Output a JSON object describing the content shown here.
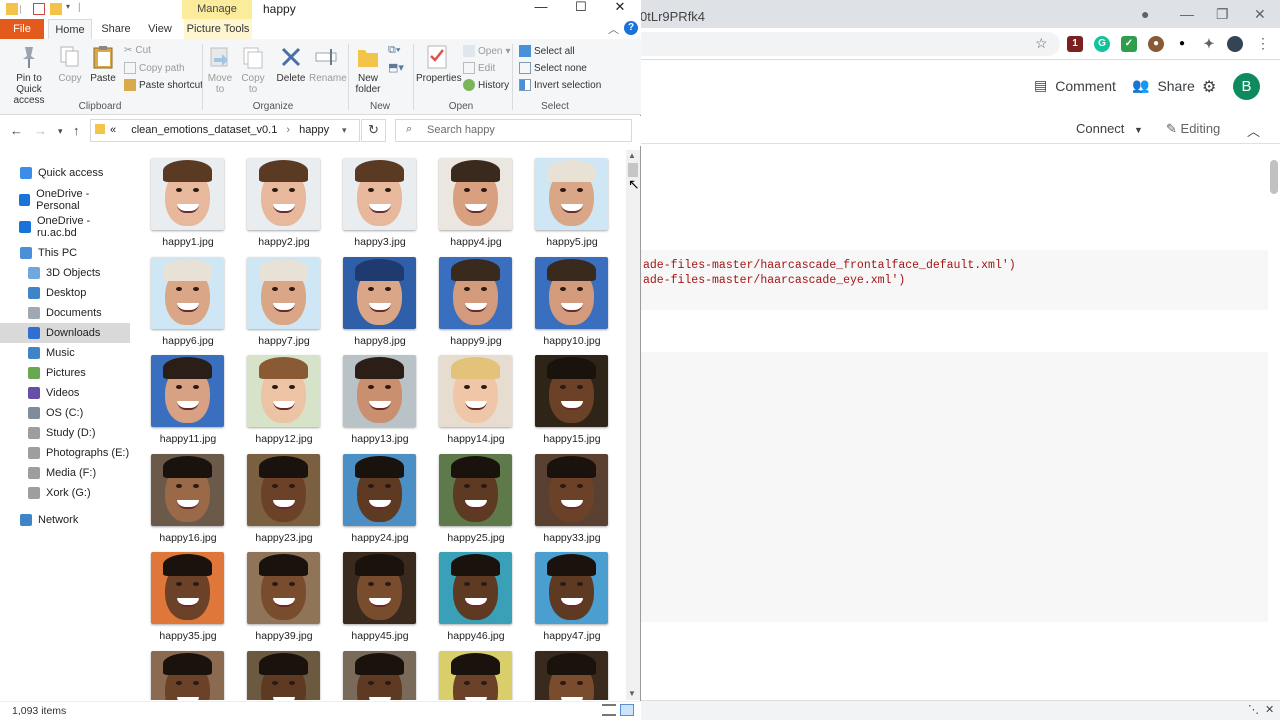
{
  "explorer": {
    "window_title": "happy",
    "manage_label": "Manage",
    "tabs": [
      {
        "label": "File"
      },
      {
        "label": "Home"
      },
      {
        "label": "Share"
      },
      {
        "label": "View"
      },
      {
        "label": "Picture Tools"
      }
    ],
    "ribbon": {
      "clipboard": {
        "pin_label": "Pin to Quick access",
        "copy_label": "Copy",
        "paste_label": "Paste",
        "cut_label": "Cut",
        "copy_path_label": "Copy path",
        "paste_shortcut_label": "Paste shortcut",
        "group_label": "Clipboard"
      },
      "organize": {
        "move_to_label": "Move to",
        "copy_to_label": "Copy to",
        "delete_label": "Delete",
        "rename_label": "Rename",
        "group_label": "Organize"
      },
      "new": {
        "new_folder_label": "New folder",
        "group_label": "New"
      },
      "open": {
        "properties_label": "Properties",
        "open_label": "Open",
        "edit_label": "Edit",
        "history_label": "History",
        "group_label": "Open"
      },
      "select": {
        "select_all_label": "Select all",
        "select_none_label": "Select none",
        "invert_label": "Invert selection",
        "group_label": "Select"
      }
    },
    "address": {
      "path": [
        "clean_emotions_dataset_v0.1",
        "happy"
      ],
      "prefix": "«"
    },
    "search": {
      "placeholder": "Search happy"
    },
    "nav_items": [
      {
        "label": "Quick access",
        "color": "#3b8ee8",
        "indent": 1
      },
      {
        "label": "OneDrive - Personal",
        "color": "#1a73d8",
        "indent": 1
      },
      {
        "label": "OneDrive - ru.ac.bd",
        "color": "#1a73d8",
        "indent": 1
      },
      {
        "label": "This PC",
        "color": "#4a90d9",
        "indent": 1
      },
      {
        "label": "3D Objects",
        "color": "#6fa8dc",
        "indent": 2
      },
      {
        "label": "Desktop",
        "color": "#3d85c6",
        "indent": 2
      },
      {
        "label": "Documents",
        "color": "#9fa8b3",
        "indent": 2
      },
      {
        "label": "Downloads",
        "color": "#2f6fd1",
        "indent": 2,
        "selected": true
      },
      {
        "label": "Music",
        "color": "#3d85c6",
        "indent": 2
      },
      {
        "label": "Pictures",
        "color": "#6aa84f",
        "indent": 2
      },
      {
        "label": "Videos",
        "color": "#674ea7",
        "indent": 2
      },
      {
        "label": "OS (C:)",
        "color": "#7f8c99",
        "indent": 2
      },
      {
        "label": "Study (D:)",
        "color": "#9e9e9e",
        "indent": 2
      },
      {
        "label": "Photographs (E:)",
        "color": "#9e9e9e",
        "indent": 2
      },
      {
        "label": "Media (F:)",
        "color": "#9e9e9e",
        "indent": 2
      },
      {
        "label": "Xork (G:)",
        "color": "#9e9e9e",
        "indent": 2
      },
      {
        "label": "Network",
        "color": "#3d85c6",
        "indent": 1
      }
    ],
    "files": [
      {
        "name": "happy1.jpg",
        "bg": "#e9edf0",
        "skin": "#e7b89b",
        "hair": "#5a3a22"
      },
      {
        "name": "happy2.jpg",
        "bg": "#e9edf0",
        "skin": "#e7b89b",
        "hair": "#5a3a22"
      },
      {
        "name": "happy3.jpg",
        "bg": "#e9edf0",
        "skin": "#e7b89b",
        "hair": "#5a3a22"
      },
      {
        "name": "happy4.jpg",
        "bg": "#ece6e1",
        "skin": "#d9a07f",
        "hair": "#3a2a1e"
      },
      {
        "name": "happy5.jpg",
        "bg": "#cfe6f5",
        "skin": "#d9a787",
        "hair": "#e8e2d6"
      },
      {
        "name": "happy6.jpg",
        "bg": "#cfe6f5",
        "skin": "#d9a787",
        "hair": "#e8e2d6"
      },
      {
        "name": "happy7.jpg",
        "bg": "#cfe6f5",
        "skin": "#d9a787",
        "hair": "#e8e2d6"
      },
      {
        "name": "happy8.jpg",
        "bg": "#2f5fa8",
        "skin": "#d9a787",
        "hair": "#1f3a6e"
      },
      {
        "name": "happy9.jpg",
        "bg": "#3a6fc0",
        "skin": "#d39b7c",
        "hair": "#3a2a1e"
      },
      {
        "name": "happy10.jpg",
        "bg": "#3a6fc0",
        "skin": "#d39b7c",
        "hair": "#3a2a1e"
      },
      {
        "name": "happy11.jpg",
        "bg": "#3a6fc0",
        "skin": "#d8a184",
        "hair": "#2a1e16"
      },
      {
        "name": "happy12.jpg",
        "bg": "#d7e3c8",
        "skin": "#edc3a6",
        "hair": "#8a5a34"
      },
      {
        "name": "happy13.jpg",
        "bg": "#b9c2c6",
        "skin": "#c98f6e",
        "hair": "#2a1e16"
      },
      {
        "name": "happy14.jpg",
        "bg": "#e6ddd0",
        "skin": "#f0c6a8",
        "hair": "#e3c37a"
      },
      {
        "name": "happy15.jpg",
        "bg": "#2e2418",
        "skin": "#6b4228",
        "hair": "#1a120c"
      },
      {
        "name": "happy16.jpg",
        "bg": "#6b5a4a",
        "skin": "#9a6a48",
        "hair": "#1a120c"
      },
      {
        "name": "happy23.jpg",
        "bg": "#7a6040",
        "skin": "#6b4228",
        "hair": "#1a120c"
      },
      {
        "name": "happy24.jpg",
        "bg": "#4b8fc4",
        "skin": "#5e3a22",
        "hair": "#1a120c"
      },
      {
        "name": "happy25.jpg",
        "bg": "#5e7a4a",
        "skin": "#5e3a22",
        "hair": "#1a120c"
      },
      {
        "name": "happy33.jpg",
        "bg": "#5a4030",
        "skin": "#6b4228",
        "hair": "#1a120c"
      },
      {
        "name": "happy35.jpg",
        "bg": "#e0773a",
        "skin": "#6b4228",
        "hair": "#1a120c"
      },
      {
        "name": "happy39.jpg",
        "bg": "#8f7458",
        "skin": "#7a4c2e",
        "hair": "#1a120c"
      },
      {
        "name": "happy45.jpg",
        "bg": "#3a2a1e",
        "skin": "#7a4c2e",
        "hair": "#1a120c"
      },
      {
        "name": "happy46.jpg",
        "bg": "#3aa0b8",
        "skin": "#5e3a22",
        "hair": "#1a120c"
      },
      {
        "name": "happy47.jpg",
        "bg": "#4a9fd0",
        "skin": "#5e3a22",
        "hair": "#1a120c"
      },
      {
        "name": "",
        "bg": "#8a6a50",
        "skin": "#6b4228",
        "hair": "#1a120c"
      },
      {
        "name": "",
        "bg": "#6b5a40",
        "skin": "#5e3a22",
        "hair": "#1a120c"
      },
      {
        "name": "",
        "bg": "#7a6a5a",
        "skin": "#5e3a22",
        "hair": "#1a120c"
      },
      {
        "name": "",
        "bg": "#d9cf6a",
        "skin": "#6b4228",
        "hair": "#1a120c"
      },
      {
        "name": "",
        "bg": "#3a2a1e",
        "skin": "#7a4c2e",
        "hair": "#1a120c"
      }
    ],
    "status": {
      "items_count": "1,093 items"
    }
  },
  "chrome": {
    "url_fragment": "0tLr9PRfk4",
    "comment_label": "Comment",
    "share_label": "Share",
    "avatar_letter": "B",
    "connect_label": "Connect",
    "editing_label": "Editing",
    "code_lines": [
      "ade-files-master/haarcascade_frontalface_default.xml')",
      "ade-files-master/haarcascade_eye.xml')"
    ]
  }
}
